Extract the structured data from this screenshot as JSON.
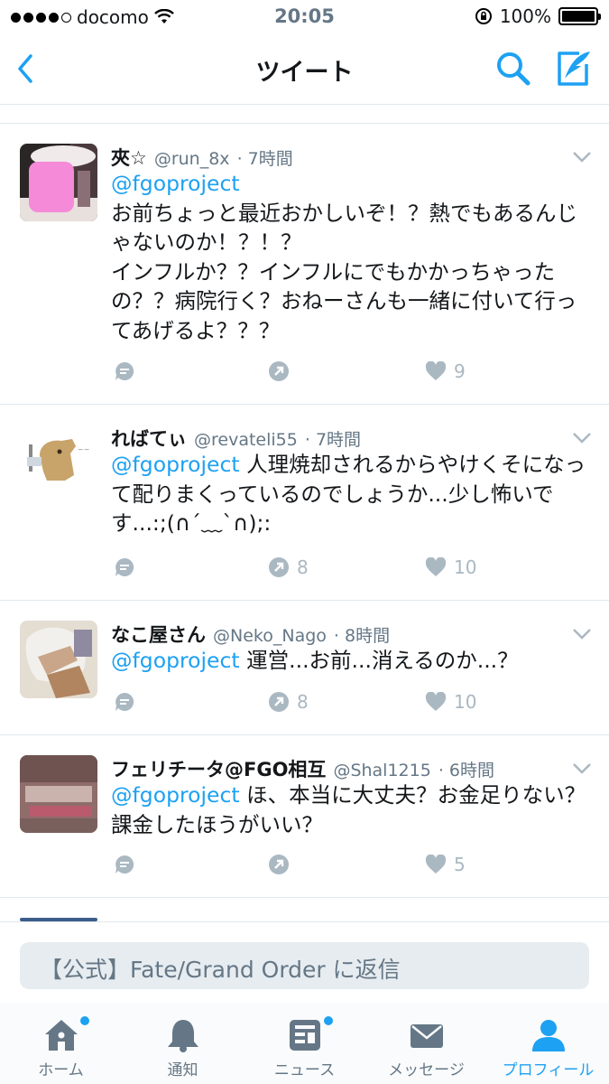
{
  "status_bar": {
    "carrier": "docomo",
    "time": "20:05",
    "battery": "100%"
  },
  "nav": {
    "title": "ツイート"
  },
  "tweets": [
    {
      "name": "夾☆",
      "handle": "@run_8x",
      "time": "· 7時間",
      "mention": "@fgoproject",
      "text": "お前ちょっと最近おかしいぞ！？熱でもあるんじゃないのか！？！？\nインフルか？？インフルにでもかかっちゃったの？？病院行く？おねーさんも一緒に付いて行ってあげるよ？？？",
      "retweets": "",
      "likes": "9"
    },
    {
      "name": "ればてぃ",
      "handle": "@revateli55",
      "time": "· 7時間",
      "mention": "@fgoproject",
      "text": "人理焼却されるからやけくそになって配りまくっているのでしょうか...少し怖いです...:;(∩´﹏`∩);:",
      "retweets": "8",
      "likes": "10"
    },
    {
      "name": "なこ屋さん",
      "handle": "@Neko_Nago",
      "time": "· 8時間",
      "mention": "@fgoproject",
      "text": "運営...お前...消えるのか...？",
      "retweets": "8",
      "likes": "10"
    },
    {
      "name": "フェリチータ@FGO相互",
      "handle": "@Shal1215",
      "time": "· 6時間",
      "mention": "@fgoproject",
      "text": "ほ、本当に大丈夫？お金足りない？課金したほうがいい？",
      "retweets": "",
      "likes": "5"
    }
  ],
  "reply": {
    "placeholder": "【公式】Fate/Grand Order に返信"
  },
  "tabs": [
    {
      "label": "ホーム",
      "icon": "home-icon"
    },
    {
      "label": "通知",
      "icon": "bell-icon"
    },
    {
      "label": "ニュース",
      "icon": "news-icon"
    },
    {
      "label": "メッセージ",
      "icon": "mail-icon"
    },
    {
      "label": "プロフィール",
      "icon": "person-icon"
    }
  ],
  "colors": {
    "accent": "#1da1f2",
    "muted": "#657786",
    "action": "#aab8c2"
  }
}
